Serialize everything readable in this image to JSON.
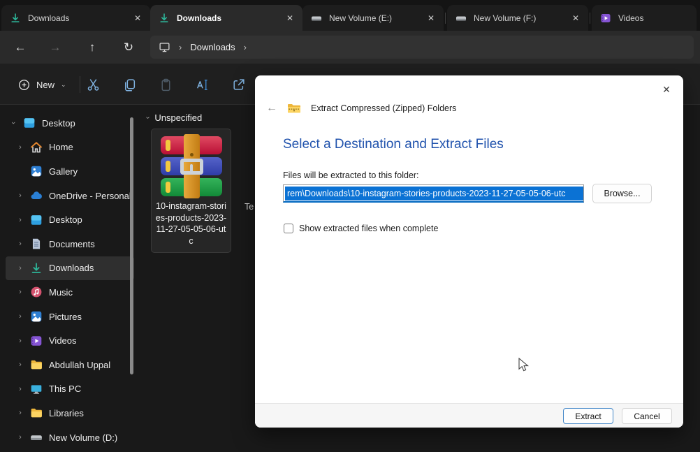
{
  "tabs": [
    {
      "label": "Downloads",
      "icon": "downloads-icon",
      "active": false
    },
    {
      "label": "Downloads",
      "icon": "downloads-icon",
      "active": true
    },
    {
      "label": "New Volume (E:)",
      "icon": "drive-icon",
      "active": false
    },
    {
      "label": "New Volume (F:)",
      "icon": "drive-icon",
      "active": false
    },
    {
      "label": "Videos",
      "icon": "videos-icon",
      "active": false
    }
  ],
  "breadcrumb": {
    "segment": "Downloads"
  },
  "toolbar": {
    "new_label": "New"
  },
  "sidebar": {
    "items": [
      {
        "label": "Desktop",
        "icon": "desktop-icon",
        "expanded": true,
        "selected": false
      },
      {
        "label": "Home",
        "icon": "home-icon",
        "expanded": false,
        "selected": false
      },
      {
        "label": "Gallery",
        "icon": "gallery-icon",
        "expanded": false,
        "selected": false
      },
      {
        "label": "OneDrive - Personal",
        "icon": "onedrive-icon",
        "expanded": false,
        "selected": false
      },
      {
        "label": "Desktop",
        "icon": "desktop-icon",
        "expanded": false,
        "selected": false
      },
      {
        "label": "Documents",
        "icon": "documents-icon",
        "expanded": false,
        "selected": false
      },
      {
        "label": "Downloads",
        "icon": "downloads-icon",
        "expanded": false,
        "selected": true
      },
      {
        "label": "Music",
        "icon": "music-icon",
        "expanded": false,
        "selected": false
      },
      {
        "label": "Pictures",
        "icon": "pictures-icon",
        "expanded": false,
        "selected": false
      },
      {
        "label": "Videos",
        "icon": "videos-icon",
        "expanded": false,
        "selected": false
      },
      {
        "label": "Abdullah Uppal",
        "icon": "folder-icon",
        "expanded": false,
        "selected": false
      },
      {
        "label": "This PC",
        "icon": "this-pc-icon",
        "expanded": false,
        "selected": false
      },
      {
        "label": "Libraries",
        "icon": "folder-icon",
        "expanded": false,
        "selected": false
      },
      {
        "label": "New Volume (D:)",
        "icon": "drive-icon",
        "expanded": false,
        "selected": false
      }
    ]
  },
  "main": {
    "group_label": "Unspecified",
    "file_name": "10-instagram-stories-products-2023-11-27-05-05-06-utc",
    "occluded_text": "Te"
  },
  "dialog": {
    "title": "Extract Compressed (Zipped) Folders",
    "heading": "Select a Destination and Extract Files",
    "field_label": "Files will be extracted to this folder:",
    "path_text": "rem\\Downloads\\10-instagram-stories-products-2023-11-27-05-05-06-utc",
    "browse_label": "Browse...",
    "checkbox_label": "Show extracted files when complete",
    "checkbox_checked": false,
    "extract_label": "Extract",
    "cancel_label": "Cancel"
  },
  "colors": {
    "accent": "#0067c0",
    "selection_blue": "#0b72d4",
    "heading_blue": "#2153ad",
    "download_green": "#2db79a"
  }
}
